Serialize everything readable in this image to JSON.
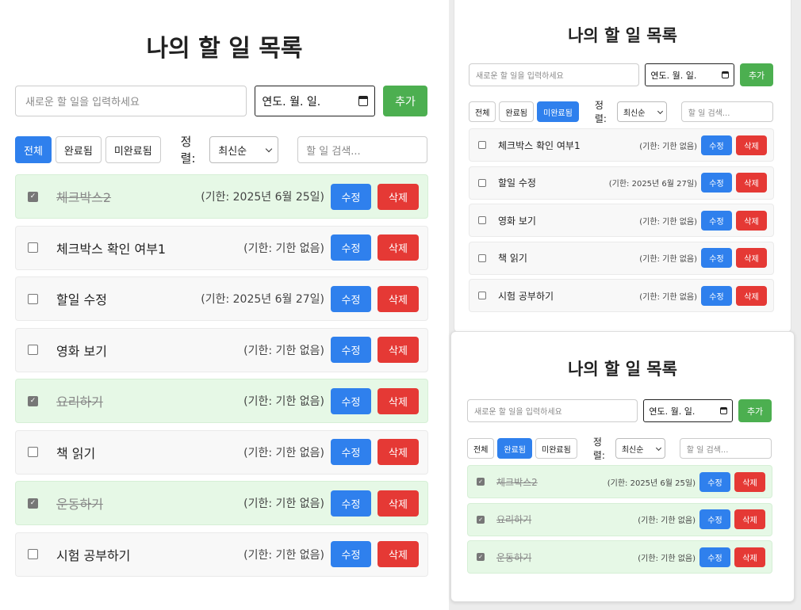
{
  "panels": [
    {
      "title": "나의 할 일 목록",
      "input_placeholder": "새로운 할 일을 입력하세요",
      "date_value": "연도. 월. 일.",
      "add_label": "추가",
      "filters": [
        "전체",
        "완료됨",
        "미완료됨"
      ],
      "active_filter": 0,
      "sort_label": "정렬:",
      "sort_value": "최신순",
      "search_placeholder": "할 일 검색...",
      "edit_label": "수정",
      "delete_label": "삭제",
      "items": [
        {
          "text": "체크박스2",
          "due": "(기한: 2025년 6월 25일)",
          "done": true
        },
        {
          "text": "체크박스 확인 여부1",
          "due": "(기한: 기한 없음)",
          "done": false
        },
        {
          "text": "할일 수정",
          "due": "(기한: 2025년 6월 27일)",
          "done": false
        },
        {
          "text": "영화 보기",
          "due": "(기한: 기한 없음)",
          "done": false
        },
        {
          "text": "요리하기",
          "due": "(기한: 기한 없음)",
          "done": true
        },
        {
          "text": "책 읽기",
          "due": "(기한: 기한 없음)",
          "done": false
        },
        {
          "text": "운동하기",
          "due": "(기한: 기한 없음)",
          "done": true
        },
        {
          "text": "시험 공부하기",
          "due": "(기한: 기한 없음)",
          "done": false
        }
      ]
    },
    {
      "title": "나의 할 일 목록",
      "input_placeholder": "새로운 할 일을 입력하세요",
      "date_value": "연도. 월. 일.",
      "add_label": "추가",
      "filters": [
        "전체",
        "완료됨",
        "미완료됨"
      ],
      "active_filter": 2,
      "sort_label": "정렬:",
      "sort_value": "최신순",
      "search_placeholder": "할 일 검색...",
      "edit_label": "수정",
      "delete_label": "삭제",
      "items": [
        {
          "text": "체크박스 확인 여부1",
          "due": "(기한: 기한 없음)",
          "done": false
        },
        {
          "text": "할일 수정",
          "due": "(기한: 2025년 6월 27일)",
          "done": false
        },
        {
          "text": "영화 보기",
          "due": "(기한: 기한 없음)",
          "done": false
        },
        {
          "text": "책 읽기",
          "due": "(기한: 기한 없음)",
          "done": false
        },
        {
          "text": "시험 공부하기",
          "due": "(기한: 기한 없음)",
          "done": false
        }
      ]
    },
    {
      "title": "나의 할 일 목록",
      "input_placeholder": "새로운 할 일을 입력하세요",
      "date_value": "연도. 월. 일.",
      "add_label": "추가",
      "filters": [
        "전체",
        "완료됨",
        "미완료됨"
      ],
      "active_filter": 1,
      "sort_label": "정렬:",
      "sort_value": "최신순",
      "search_placeholder": "할 일 검색...",
      "edit_label": "수정",
      "delete_label": "삭제",
      "items": [
        {
          "text": "체크박스2",
          "due": "(기한: 2025년 6월 25일)",
          "done": true
        },
        {
          "text": "요리하기",
          "due": "(기한: 기한 없음)",
          "done": true
        },
        {
          "text": "운동하기",
          "due": "(기한: 기한 없음)",
          "done": true
        }
      ]
    }
  ]
}
